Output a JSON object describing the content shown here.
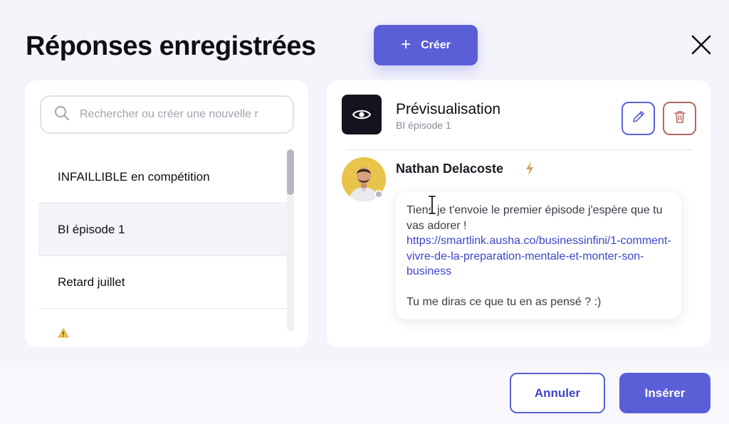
{
  "header": {
    "title": "Réponses enregistrées",
    "create_label": "Créer",
    "accent": "#5a5fd8"
  },
  "search": {
    "placeholder": "Rechercher ou créer une nouvelle r",
    "icon": "search-icon"
  },
  "list": {
    "items": [
      {
        "label": "INFAILLIBLE en compétition",
        "selected": false
      },
      {
        "label": "BI épisode 1",
        "selected": true
      },
      {
        "label": "Retard juillet",
        "selected": false
      },
      {
        "label": "⚠️",
        "selected": false
      }
    ]
  },
  "preview": {
    "title": "Prévisualisation",
    "subtitle": "BI épisode 1",
    "icon": "eye-icon",
    "edit_icon": "pencil-icon",
    "delete_icon": "trash-icon",
    "delete_color": "#b5675e"
  },
  "message": {
    "sender": "Nathan Delacoste",
    "badge_icon": "lightning-icon",
    "intro": "Tiens je t'envoie le premier épisode j'espère que tu vas adorer !",
    "link": "https://smartlink.ausha.co/businessinfini/1-comment-vivre-de-la-preparation-mentale-et-monter-son-business",
    "outro": "Tu me diras ce que tu en as pensé ? :)"
  },
  "footer": {
    "cancel_label": "Annuler",
    "insert_label": "Insérer"
  }
}
